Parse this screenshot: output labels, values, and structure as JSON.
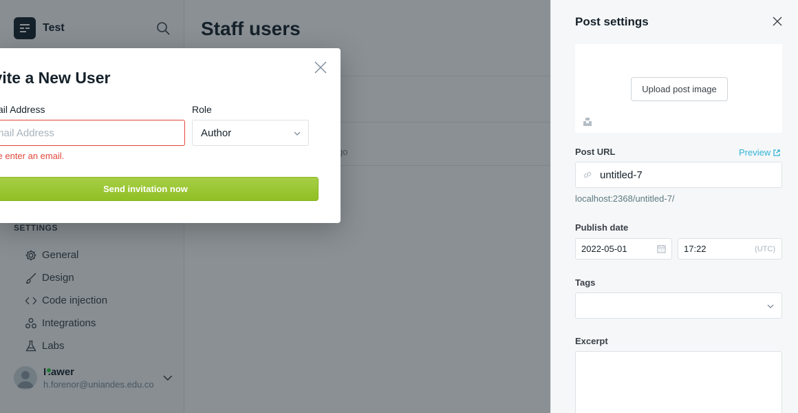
{
  "sidebar": {
    "brand_name": "Test",
    "brand_sub": "",
    "settings_title": "SETTINGS",
    "nav": [
      {
        "label": "General",
        "icon": "gear-icon"
      },
      {
        "label": "Design",
        "icon": "brush-icon"
      },
      {
        "label": "Code injection",
        "icon": "code-icon"
      },
      {
        "label": "Integrations",
        "icon": "integrations-icon"
      },
      {
        "label": "Labs",
        "icon": "flask-icon"
      }
    ],
    "user": {
      "name": "Hawer",
      "email": "h.forenor@uniandes.edu.co"
    }
  },
  "main": {
    "title": "Staff users",
    "row_meta": "go"
  },
  "invite_modal": {
    "title": "Invite a New User",
    "email_label": "Email Address",
    "email_placeholder": "Email Address",
    "email_error": "Please enter an email.",
    "role_label": "Role",
    "role_value": "Author",
    "send_button": "Send invitation now"
  },
  "post_settings": {
    "title": "Post settings",
    "upload_button": "Upload post image",
    "post_url_label": "Post URL",
    "preview_link": "Preview",
    "post_url_value": "untitled-7",
    "post_url_hint": "localhost:2368/untitled-7/",
    "publish_date_label": "Publish date",
    "date_value": "2022-05-01",
    "time_value": "17:22",
    "timezone": "(UTC)",
    "tags_label": "Tags",
    "excerpt_label": "Excerpt"
  },
  "colors": {
    "accent": "#30b3d6",
    "error": "#e0473a",
    "primary_button": "#9bc73a",
    "overlay": "rgba(21,33,42,0.5)"
  }
}
